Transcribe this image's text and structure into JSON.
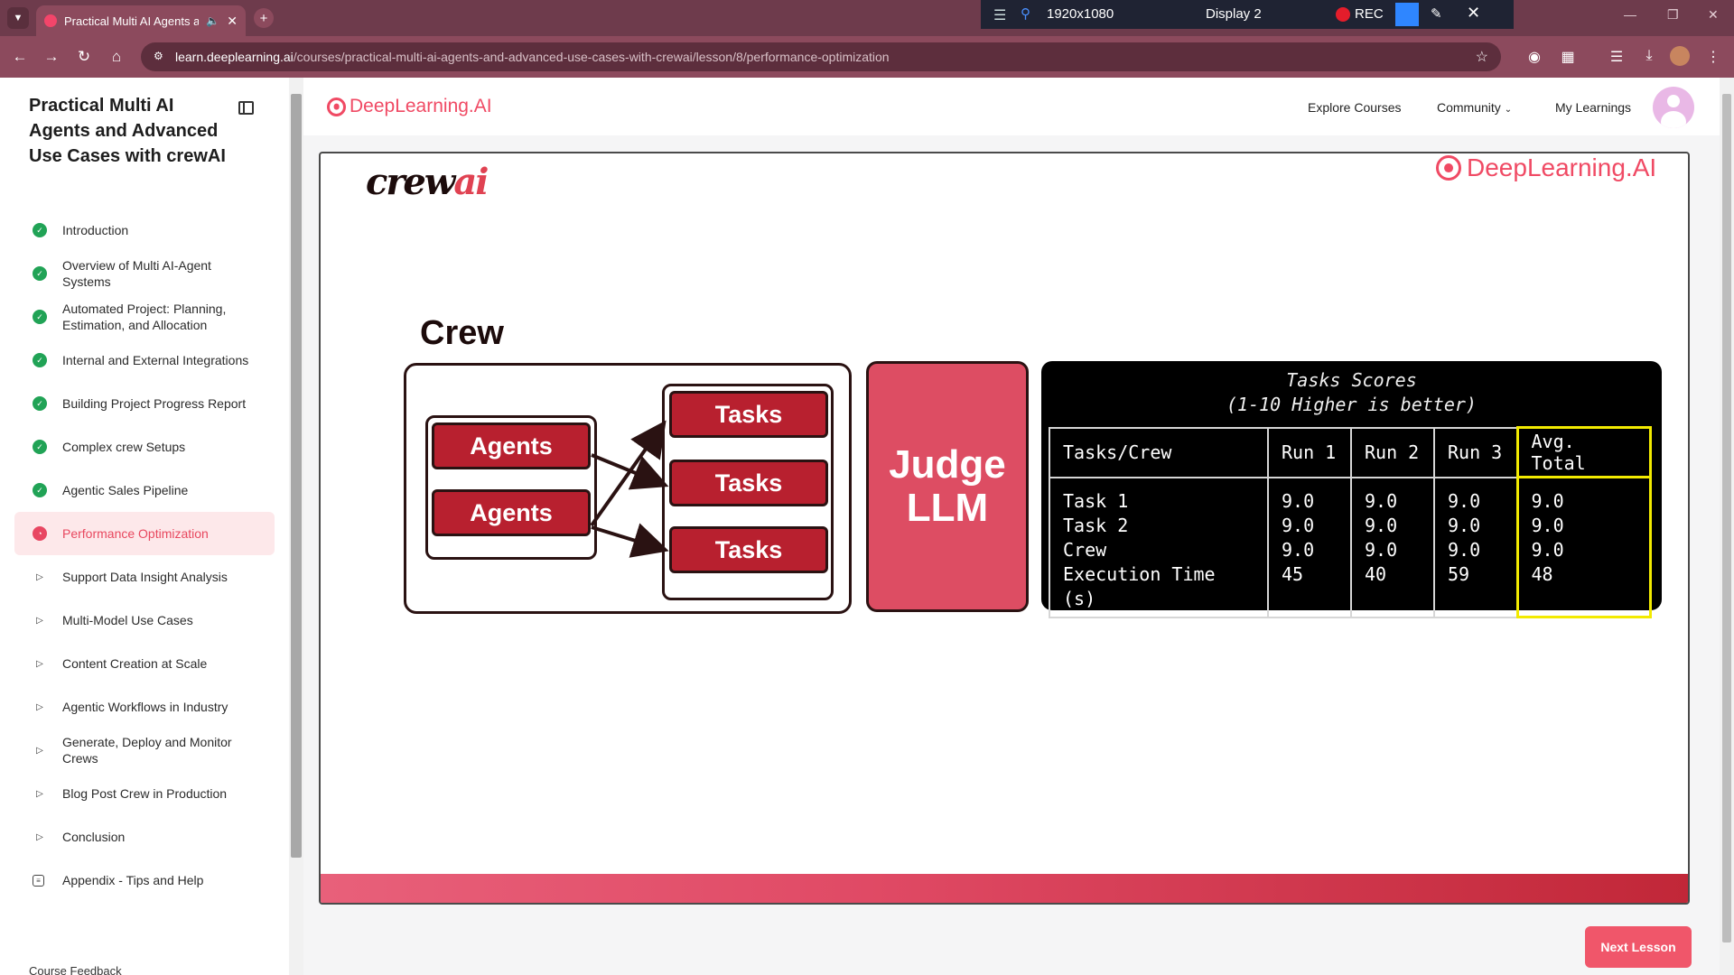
{
  "browser": {
    "tab_title": "Practical Multi AI Agents an",
    "url_host": "learn.deeplearning.ai",
    "url_path": "/courses/practical-multi-ai-agents-and-advanced-use-cases-with-crewai/lesson/8/performance-optimization"
  },
  "recorder": {
    "resolution": "1920x1080",
    "display": "Display 2",
    "rec_label": "REC"
  },
  "sidebar": {
    "course_title": "Practical Multi AI Agents and Advanced Use Cases with crewAI",
    "lessons": [
      {
        "label": "Introduction",
        "status": "done"
      },
      {
        "label": "Overview of Multi AI-Agent Systems",
        "status": "done"
      },
      {
        "label": "Automated Project: Planning, Estimation, and Allocation",
        "status": "done"
      },
      {
        "label": "Internal and External Integrations",
        "status": "done"
      },
      {
        "label": "Building Project Progress Report",
        "status": "done"
      },
      {
        "label": "Complex crew Setups",
        "status": "done"
      },
      {
        "label": "Agentic Sales Pipeline",
        "status": "done"
      },
      {
        "label": "Performance Optimization",
        "status": "current"
      },
      {
        "label": "Support Data Insight Analysis",
        "status": "video"
      },
      {
        "label": "Multi-Model Use Cases",
        "status": "video"
      },
      {
        "label": "Content Creation at Scale",
        "status": "video"
      },
      {
        "label": "Agentic Workflows in Industry",
        "status": "video"
      },
      {
        "label": "Generate, Deploy and Monitor Crews",
        "status": "video"
      },
      {
        "label": "Blog Post Crew in Production",
        "status": "video"
      },
      {
        "label": "Conclusion",
        "status": "video"
      },
      {
        "label": "Appendix - Tips and Help",
        "status": "appendix"
      }
    ],
    "feedback_label": "Course Feedback"
  },
  "topnav": {
    "logo": "DeepLearning.AI",
    "explore": "Explore Courses",
    "community": "Community",
    "my_learnings": "My Learnings"
  },
  "slide": {
    "crewai_logo_a": "crew",
    "crewai_logo_b": "ai",
    "dl_logo": "DeepLearning.AI",
    "crew_label": "Crew",
    "agents": [
      "Agents",
      "Agents"
    ],
    "tasks": [
      "Tasks",
      "Tasks",
      "Tasks"
    ],
    "judge_line1": "Judge",
    "judge_line2": "LLM",
    "scores_title_line1": "Tasks Scores",
    "scores_title_line2": "(1-10 Higher is better)",
    "headers": [
      "Tasks/Crew",
      "Run 1",
      "Run 2",
      "Run 3",
      "Avg. Total"
    ],
    "row_labels": [
      "Task 1",
      "Task 2",
      "Crew",
      "Execution Time (s)"
    ],
    "runs": [
      [
        "9.0",
        "9.0",
        "9.0",
        "45"
      ],
      [
        "9.0",
        "9.0",
        "9.0",
        "40"
      ],
      [
        "9.0",
        "9.0",
        "9.0",
        "59"
      ],
      [
        "9.0",
        "9.0",
        "9.0",
        "48"
      ]
    ],
    "highlight_color": "#f2ea00"
  },
  "next_lesson": "Next Lesson",
  "colors": {
    "brand": "#f04a64",
    "done": "#21a356",
    "chrome": "#8c4a5d"
  }
}
